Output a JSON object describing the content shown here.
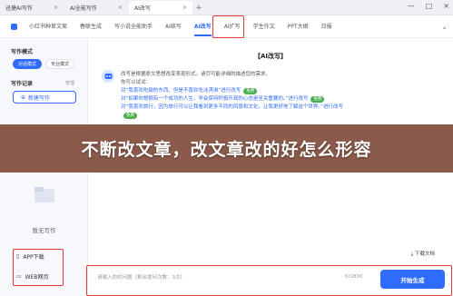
{
  "browser": {
    "tabs": [
      {
        "label": "迅捷AI写作"
      },
      {
        "label": "AI全能写作"
      },
      {
        "label": "AI改写"
      }
    ],
    "new_tab": "+",
    "window_controls": [
      "—",
      "□",
      "×"
    ]
  },
  "nav": {
    "items": [
      {
        "label": "小红书种草文案"
      },
      {
        "label": "春联生成"
      },
      {
        "label": "写小说全能助手"
      },
      {
        "label": "AI续写"
      },
      {
        "label": "AI改写"
      },
      {
        "label": "AI扩写"
      },
      {
        "label": "学生作文"
      },
      {
        "label": "PPT大纲"
      },
      {
        "label": "日报"
      }
    ],
    "active_index": 4
  },
  "sidebar": {
    "mode_title": "写作模式",
    "modes": [
      {
        "label": "对话模式"
      },
      {
        "label": "专业模式"
      }
    ],
    "history_title": "写作记录",
    "manage": "管理",
    "new_button": "新建写作",
    "empty_text": "暂无写作",
    "links": [
      {
        "label": "APP下载"
      },
      {
        "label": "WEB网页"
      }
    ]
  },
  "main": {
    "heading": "【AI改写】",
    "intro_lines": [
      "改写是根据原文思想改变表现形式。请尽可能详细的描述您的需求。",
      "你可以试试："
    ],
    "examples": [
      {
        "text": "对“我喜欢吃甜的东西，但是不喜欢吃冰淇淋”进行改写",
        "tag": "免费"
      },
      {
        "text": "对“如果你想拥有一个成功的人生，学会保持积极乐观的心态是至关重要的。”进行改写",
        "tag": "免费"
      },
      {
        "text": "对“我喜欢旅行，因为旅行可以让我看到更多不同的风景和文化，让我更好地了解这个世界。”进行改写",
        "tag": "免费"
      }
    ],
    "download": "下载文档"
  },
  "banner": {
    "text": "不断改文章，改文章改的好怎么形容"
  },
  "input": {
    "placeholder": "请输入你的问题（剩余提问次数：3次）",
    "counter": "0/1800",
    "submit": "开始生成"
  },
  "colors": {
    "accent": "#2f6bff",
    "highlight_box": "#e53935",
    "banner": "#8a5a4a"
  }
}
